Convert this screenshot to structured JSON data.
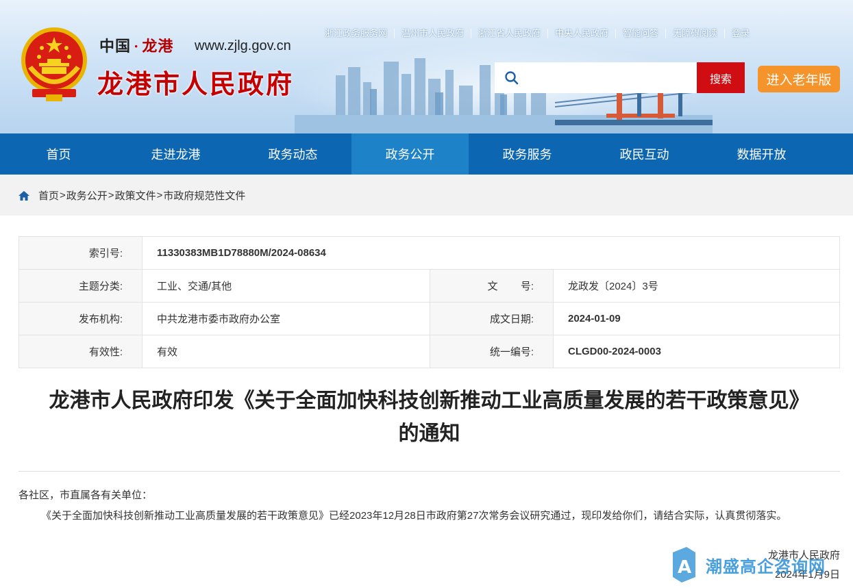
{
  "header": {
    "brand_cn": "中国",
    "brand_dot": "·",
    "brand_city": "龙港",
    "site_url": "www.zjlg.gov.cn",
    "site_title": "龙港市人民政府",
    "top_links": [
      "浙江政务服务网",
      "温州市人民政府",
      "浙江省人民政府",
      "中央人民政府",
      "智能问答",
      "无障碍阅读",
      "登录"
    ],
    "search_placeholder": "",
    "search_button": "搜索",
    "elder_button": "进入老年版",
    "colors": {
      "brand_red": "#c40000",
      "search_red": "#d00d12",
      "elder_orange": "#f5942b"
    }
  },
  "nav": {
    "items": [
      "首页",
      "走进龙港",
      "政务动态",
      "政务公开",
      "政务服务",
      "政民互动",
      "数据开放"
    ],
    "active": "政务公开",
    "colors": {
      "bar": "#0c66b1",
      "active": "#1d82c8"
    }
  },
  "breadcrumb": {
    "items": [
      "首页",
      "政务公开",
      "政策文件",
      "市政府规范性文件"
    ],
    "separator": ">"
  },
  "meta": {
    "index_label": "索引号:",
    "index_value": "11330383MB1D78880M/2024-08634",
    "topic_label": "主题分类:",
    "topic_value": "工业、交通/其他",
    "docno_label": "文        号:",
    "docno_value": "龙政发〔2024〕3号",
    "org_label": "发布机构:",
    "org_value": "中共龙港市委市政府办公室",
    "date_label": "成文日期:",
    "date_value": "2024-01-09",
    "valid_label": "有效性:",
    "valid_value": "有效",
    "serial_label": "统一编号:",
    "serial_value": "CLGD00-2024-0003"
  },
  "article": {
    "title_line1": "龙港市人民政府印发《关于全面加快科技创新推动工业高质量发展的若干政策意见》",
    "title_line2": "的通知",
    "salutation": "各社区，市直属各有关单位：",
    "body": "《关于全面加快科技创新推动工业高质量发展的若干政策意见》已经2023年12月28日市政府第27次常务会议研究通过，现印发给你们，请结合实际，认真贯彻落实。",
    "signer": "龙港市人民政府",
    "sign_date": "2024年1月9日"
  },
  "watermark": {
    "text": "潮盛高企咨询网"
  }
}
